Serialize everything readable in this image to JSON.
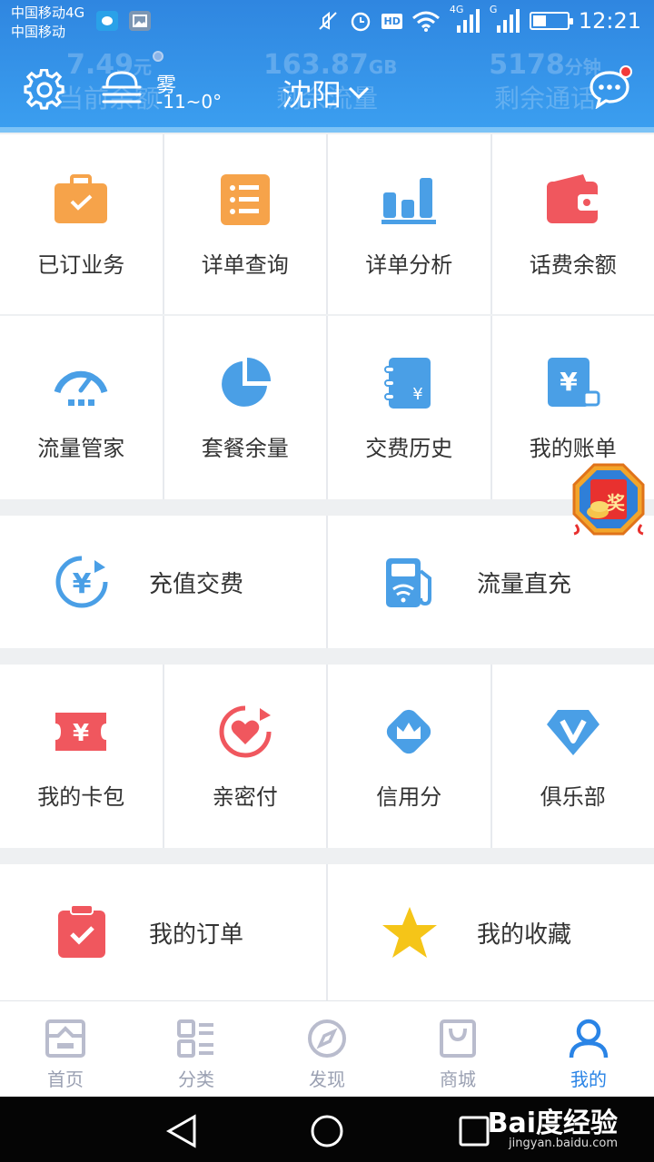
{
  "status_bar": {
    "carrier_line1": "中国移动4G",
    "carrier_line2": "中国移动",
    "network_4g": "4G",
    "network_g": "G",
    "hd": "HD",
    "time": "12:21"
  },
  "header": {
    "stats": [
      {
        "value": "7.49",
        "unit": "元",
        "label": "当前余额"
      },
      {
        "value": "163.87",
        "unit": "GB",
        "label": "剩余流量"
      },
      {
        "value": "5178",
        "unit": "分钟",
        "label": "剩余通话"
      }
    ],
    "weather_condition": "雾",
    "weather_temp": "-11~0°",
    "city": "沈阳",
    "icons": {
      "settings": "gear-icon",
      "weather": "fog-icon",
      "messages": "chat-bubble-icon"
    }
  },
  "grid_row1": [
    {
      "label": "已订业务",
      "icon": "briefcase-check-icon",
      "color": "#f6a34a"
    },
    {
      "label": "详单查询",
      "icon": "list-icon",
      "color": "#f6a34a"
    },
    {
      "label": "详单分析",
      "icon": "bar-chart-icon",
      "color": "#4a9fe6"
    },
    {
      "label": "话费余额",
      "icon": "wallet-icon",
      "color": "#f0575e"
    }
  ],
  "grid_row2": [
    {
      "label": "流量管家",
      "icon": "speedometer-icon",
      "color": "#4a9fe6"
    },
    {
      "label": "套餐余量",
      "icon": "pie-chart-icon",
      "color": "#4a9fe6"
    },
    {
      "label": "交费历史",
      "icon": "notebook-yen-icon",
      "color": "#4a9fe6"
    },
    {
      "label": "我的账单",
      "icon": "bill-yen-icon",
      "color": "#4a9fe6"
    }
  ],
  "wide_row1": [
    {
      "label": "充值交费",
      "icon": "yen-circle-icon",
      "color": "#4a9fe6"
    },
    {
      "label": "流量直充",
      "icon": "fuel-wifi-icon",
      "color": "#4a9fe6"
    }
  ],
  "grid_row3": [
    {
      "label": "我的卡包",
      "icon": "ticket-yen-icon",
      "color": "#f0575e"
    },
    {
      "label": "亲密付",
      "icon": "heart-circle-icon",
      "color": "#f0575e"
    },
    {
      "label": "信用分",
      "icon": "crown-diamond-icon",
      "color": "#4a9fe6"
    },
    {
      "label": "俱乐部",
      "icon": "v-diamond-icon",
      "color": "#4a9fe6"
    }
  ],
  "wide_row2": [
    {
      "label": "我的订单",
      "icon": "clipboard-check-icon",
      "color": "#f0575e"
    },
    {
      "label": "我的收藏",
      "icon": "star-icon",
      "color": "#f5c518"
    }
  ],
  "floating_badge": {
    "text": "奖",
    "icon": "red-envelope-icon"
  },
  "tabbar": [
    {
      "label": "首页",
      "icon": "home-icon",
      "active": false
    },
    {
      "label": "分类",
      "icon": "category-grid-icon",
      "active": false
    },
    {
      "label": "发现",
      "icon": "compass-icon",
      "active": false
    },
    {
      "label": "商城",
      "icon": "shopping-bag-icon",
      "active": false
    },
    {
      "label": "我的",
      "icon": "user-icon",
      "active": true
    }
  ],
  "watermark": {
    "brand": "Bai度经验",
    "url": "jingyan.baidu.com"
  }
}
